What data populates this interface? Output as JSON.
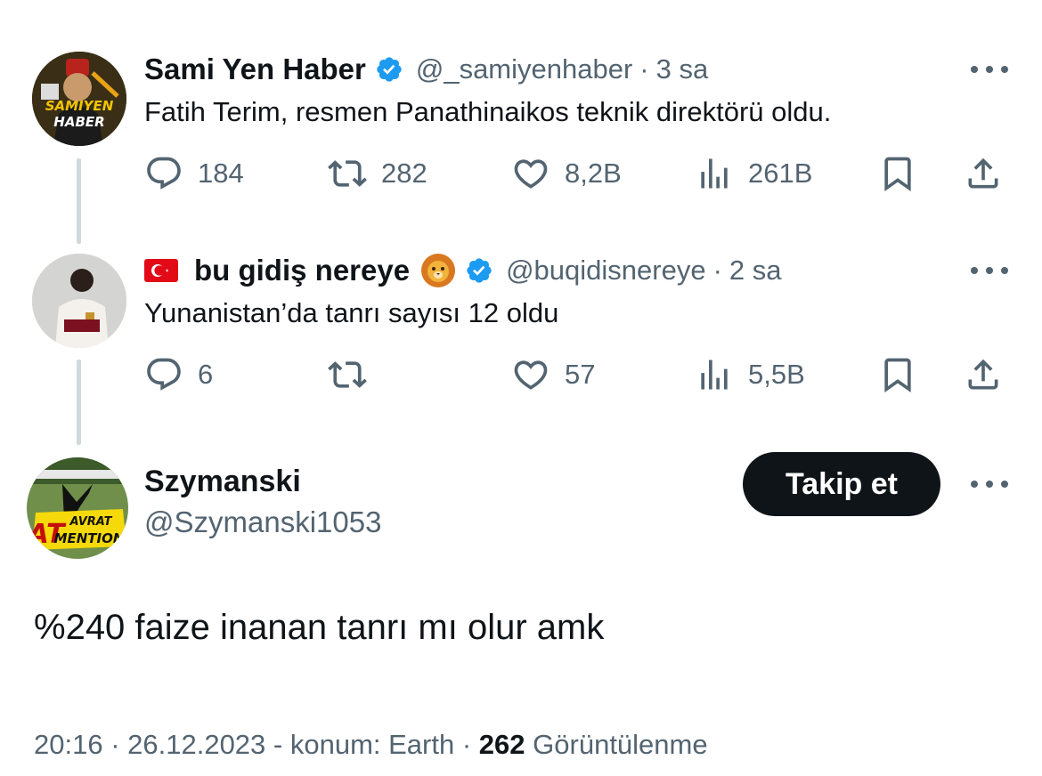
{
  "tweets": [
    {
      "name": "Sami Yen Haber",
      "handle": "@_samiyenhaber",
      "time": "3 sa",
      "text": "Fatih Terim, resmen Panathinaikos teknik direktörü oldu.",
      "avatar_text": [
        "SAMIYEN",
        "HABER"
      ],
      "replies": "184",
      "retweets": "282",
      "likes": "8,2B",
      "views": "261B"
    },
    {
      "name": "bu gidiş nereye",
      "handle": "@buqidisnereye",
      "time": "2 sa",
      "text": "Yunanistan’da tanrı sayısı 12 oldu",
      "replies": "6",
      "retweets": "",
      "likes": "57",
      "views": "5,5B"
    }
  ],
  "main": {
    "name": "Szymanski",
    "handle": "@Szymanski1053",
    "follow_label": "Takip et",
    "avatar_text": [
      "AT",
      "AVRAT",
      "MENTION"
    ],
    "text": "%240 faize inanan tanrı mı olur amk",
    "time": "20:16",
    "date": "26.12.2023",
    "location": "konum: Earth",
    "view_count": "262",
    "view_label": "Görüntülenme"
  },
  "colors": {
    "verified_blue": "#1d9bf0",
    "text_primary": "#0f1419",
    "text_secondary": "#536471",
    "thread_line": "#cfd9de"
  },
  "icons": [
    "verified-icon",
    "reply-icon",
    "retweet-icon",
    "like-icon",
    "views-icon",
    "bookmark-icon",
    "share-icon",
    "more-icon",
    "turkey-flag-icon",
    "lion-emoji-icon"
  ]
}
